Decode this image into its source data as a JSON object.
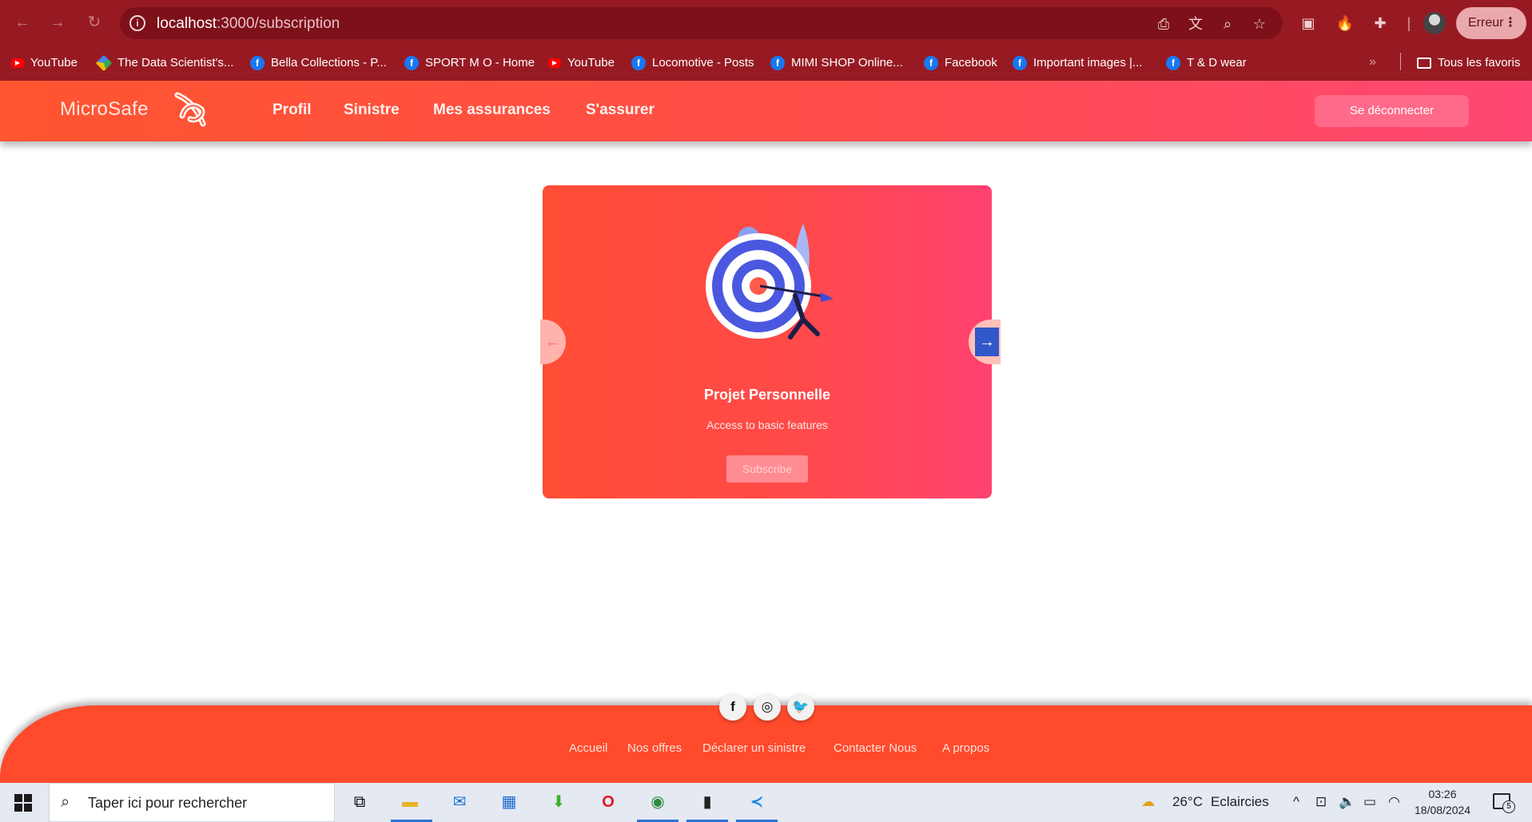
{
  "browser": {
    "url_host": "localhost",
    "url_path": ":3000/subscription",
    "profile_button": "Erreur",
    "bookmarks": [
      {
        "label": "YouTube",
        "icon": "youtube-icon"
      },
      {
        "label": "The Data Scientist's...",
        "icon": "google-drive-icon"
      },
      {
        "label": "Bella Collections - P...",
        "icon": "facebook-icon"
      },
      {
        "label": "SPORT M O - Home",
        "icon": "facebook-icon"
      },
      {
        "label": "YouTube",
        "icon": "youtube-icon"
      },
      {
        "label": "Locomotive - Posts",
        "icon": "facebook-icon"
      },
      {
        "label": "MIMI SHOP Online...",
        "icon": "facebook-icon"
      },
      {
        "label": "Facebook",
        "icon": "facebook-icon"
      },
      {
        "label": "Important images |...",
        "icon": "facebook-icon"
      },
      {
        "label": "T & D wear",
        "icon": "facebook-icon"
      }
    ],
    "all_bookmarks": "Tous les favoris"
  },
  "app": {
    "brand": "MicroSafe",
    "nav": [
      "Profil",
      "Sinistre",
      "Mes assurances",
      "S'assurer"
    ],
    "logout": "Se déconnecter",
    "colors": {
      "primary": "#ff5530",
      "accent": "#ff4773",
      "arrow": "#3158c9"
    }
  },
  "card": {
    "title": "Projet Personnelle",
    "description": "Access to basic features",
    "button": "Subscribe",
    "prev_arrow": "←",
    "next_arrow": "→"
  },
  "footer": {
    "social": [
      "facebook-icon",
      "instagram-icon",
      "twitter-icon"
    ],
    "links": [
      "Accueil",
      "Nos offres",
      "Déclarer un sinistre",
      "Contacter Nous",
      "A propos"
    ]
  },
  "taskbar": {
    "search_placeholder": "Taper ici pour rechercher",
    "weather_temp": "26°C",
    "weather_desc": "Eclaircies",
    "time": "03:26",
    "date": "18/08/2024",
    "notifications": "5"
  }
}
